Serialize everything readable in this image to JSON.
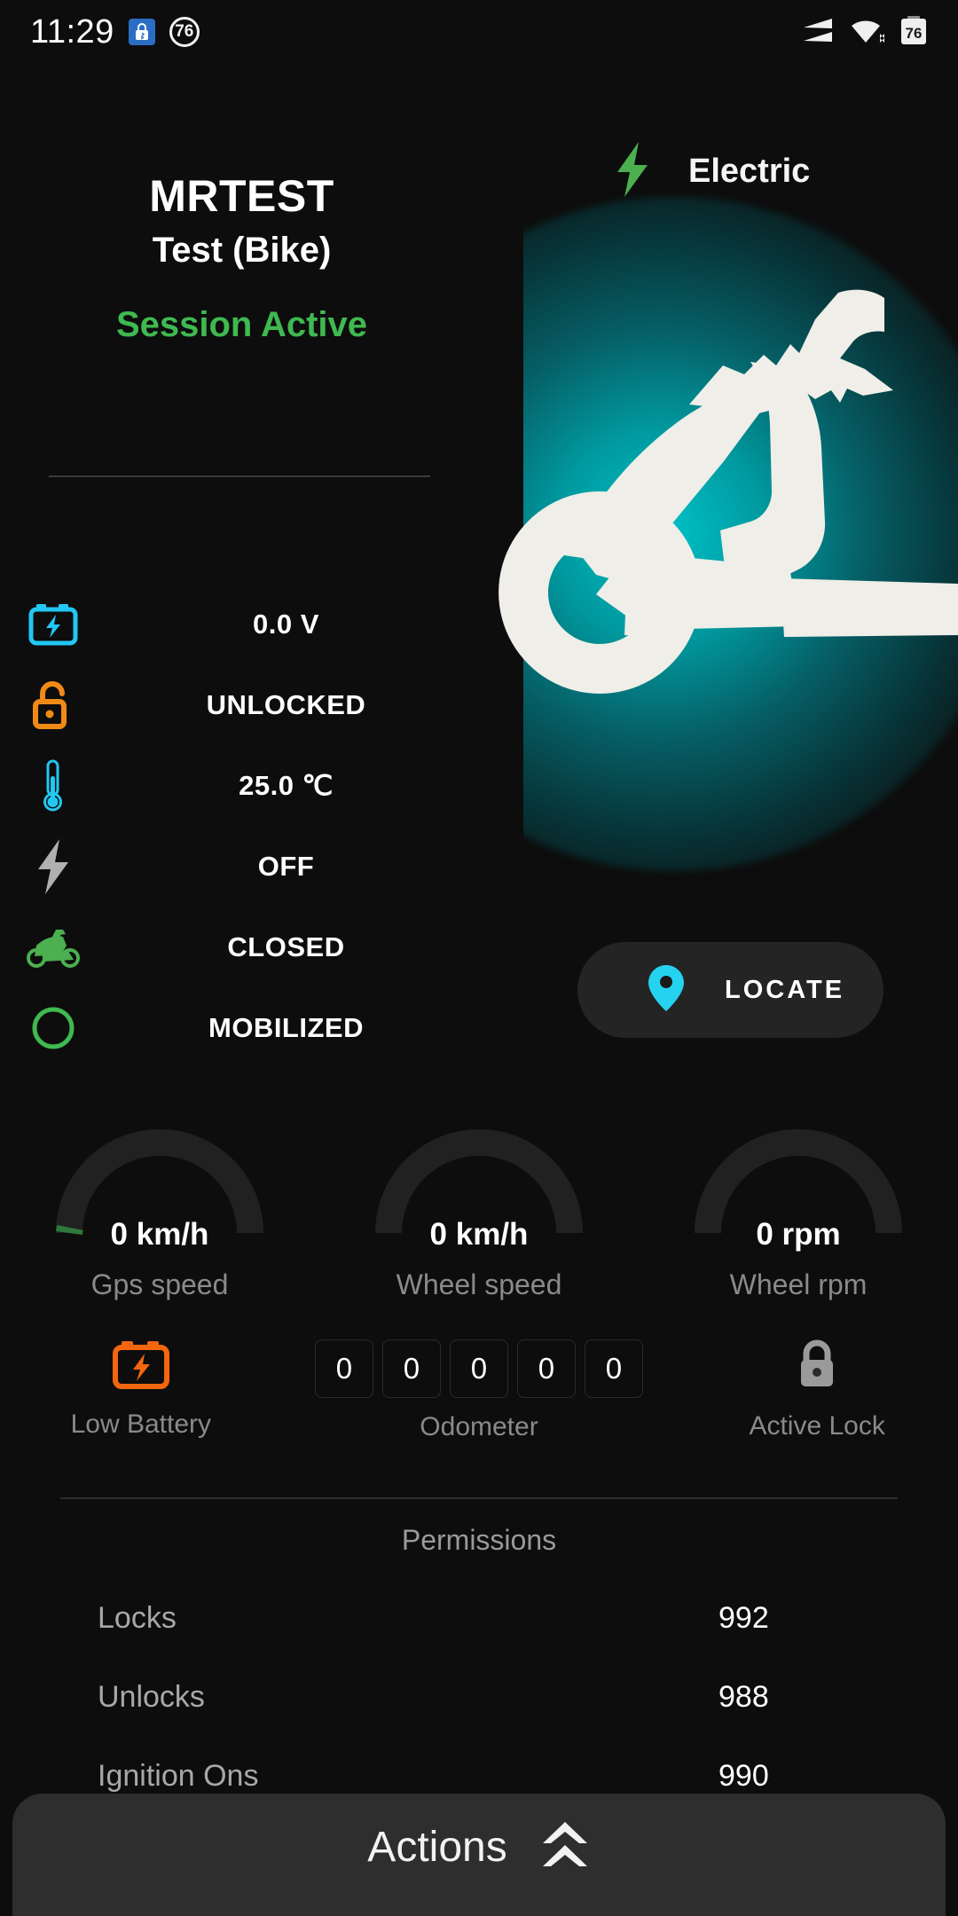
{
  "statusbar": {
    "clock": "11:29",
    "lock_badge_icon": "lock-bluetooth-icon",
    "dnd_badge_value": "76",
    "signal_icon": "cell-signal-icon",
    "wifi_icon": "wifi-icon",
    "battery_level": "76"
  },
  "hero": {
    "powertrain_icon": "lightning-bolt-icon",
    "powertrain_label": "Electric",
    "vehicle_name": "MRTEST",
    "vehicle_model": "Test (Bike)",
    "session_status": "Session Active",
    "session_status_color": "#3fb950",
    "vehicle_image": "scooter-silhouette",
    "glow_color": "#00b6bd"
  },
  "status_list": [
    {
      "icon": "battery-bolt-icon",
      "icon_color": "#22c7f2",
      "value": "0.0 V"
    },
    {
      "icon": "padlock-unlocked-icon",
      "icon_color": "#f08a16",
      "value": "UNLOCKED"
    },
    {
      "icon": "thermometer-icon",
      "icon_color": "#22c7f2",
      "value": "25.0 ℃"
    },
    {
      "icon": "lightning-bolt-icon",
      "icon_color": "#b0b0b0",
      "value": "OFF"
    },
    {
      "icon": "scooter-icon",
      "icon_color": "#4caf50",
      "value": "CLOSED"
    },
    {
      "icon": "circle-outline-icon",
      "icon_color": "#3fb950",
      "value": "MOBILIZED"
    }
  ],
  "locate_button": {
    "icon": "map-pin-icon",
    "icon_color": "#25d3f0",
    "label": "LOCATE"
  },
  "gauges": [
    {
      "value": "0 km/h",
      "label": "Gps speed",
      "indicator_color": "#2f7a3a"
    },
    {
      "value": "0 km/h",
      "label": "Wheel speed",
      "indicator_color": "#2f7a3a"
    },
    {
      "value": "0 rpm",
      "label": "Wheel rpm",
      "indicator_color": "#2f7a3a"
    }
  ],
  "metrics": {
    "low_battery": {
      "icon": "battery-low-icon",
      "icon_color": "#f2660d",
      "label": "Low Battery"
    },
    "odometer": {
      "digits": [
        "0",
        "0",
        "0",
        "0",
        "0"
      ],
      "label": "Odometer"
    },
    "active_lock": {
      "icon": "padlock-locked-icon",
      "icon_color": "#9a9a9a",
      "label": "Active Lock"
    }
  },
  "permissions": {
    "title": "Permissions",
    "rows": [
      {
        "name": "Locks",
        "value": "992"
      },
      {
        "name": "Unlocks",
        "value": "988"
      },
      {
        "name": "Ignition Ons",
        "value": "990"
      }
    ]
  },
  "actions_sheet": {
    "label": "Actions",
    "icon": "double-chevron-up-icon"
  }
}
